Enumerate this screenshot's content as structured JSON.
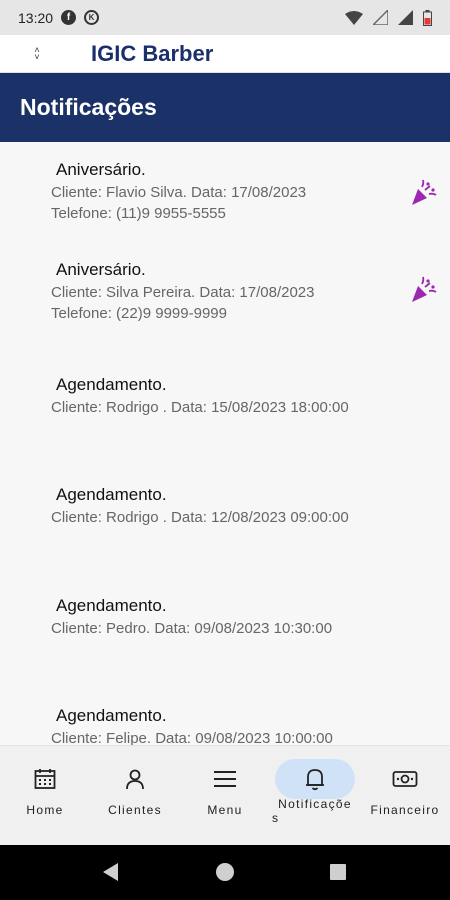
{
  "status_bar": {
    "time": "13:20",
    "notification_icons": [
      "facebook-icon",
      "circle-k-icon"
    ],
    "system_icons": [
      "wifi-icon",
      "signal-icon",
      "battery-icon"
    ]
  },
  "app_bar": {
    "title": "IGIC Barber",
    "switch_icon": "unfold-icon"
  },
  "page": {
    "title": "Notificações"
  },
  "notifications": [
    {
      "type": "Aniversário.",
      "lines": [
        "Cliente: Flavio Silva. Data: 17/08/2023",
        "Telefone: (11)9 9955-5555"
      ],
      "icon": "party-popper-icon"
    },
    {
      "type": "Aniversário.",
      "lines": [
        "Cliente: Silva Pereira. Data: 17/08/2023",
        "Telefone: (22)9 9999-9999"
      ],
      "icon": "party-popper-icon"
    },
    {
      "type": "Agendamento.",
      "lines": [
        "Cliente: Rodrigo . Data: 15/08/2023 18:00:00"
      ]
    },
    {
      "type": "Agendamento.",
      "lines": [
        "Cliente: Rodrigo . Data: 12/08/2023 09:00:00"
      ]
    },
    {
      "type": "Agendamento.",
      "lines": [
        "Cliente: Pedro. Data: 09/08/2023 10:30:00"
      ]
    },
    {
      "type": "Agendamento.",
      "lines": [
        "Cliente: Felipe. Data: 09/08/2023 10:00:00"
      ]
    }
  ],
  "bottom_nav": {
    "items": [
      {
        "label": "Home",
        "icon": "calendar-icon"
      },
      {
        "label": "Clientes",
        "icon": "person-icon"
      },
      {
        "label": "Menu",
        "icon": "menu-icon"
      },
      {
        "label": "Notificações",
        "label_line1": "Notificaçõe",
        "label_line2": "s",
        "icon": "bell-icon",
        "active": true
      },
      {
        "label": "Financeiro",
        "icon": "money-icon"
      }
    ]
  },
  "colors": {
    "header": "#1a3268",
    "app_title": "#1a2f6b",
    "party_icon": "#9c27b0",
    "active_pill": "#cfe2f7"
  }
}
